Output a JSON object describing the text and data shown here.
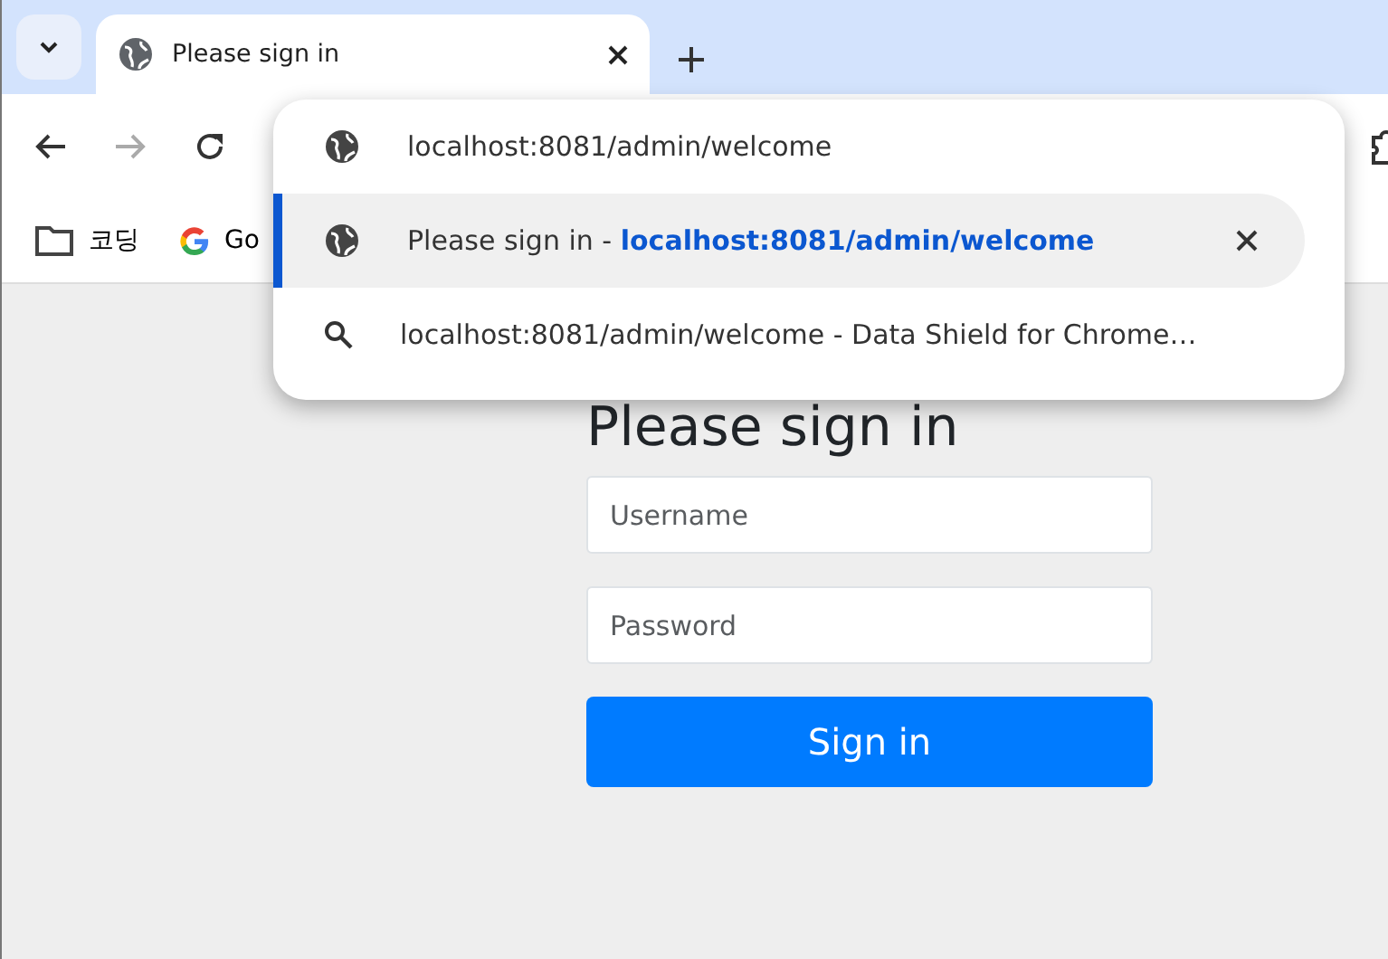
{
  "tab": {
    "title": "Please sign in"
  },
  "bookmarks": [
    {
      "label": "코딩",
      "kind": "folder"
    },
    {
      "label": "Go",
      "kind": "google"
    }
  ],
  "omnibox_suggestions": [
    {
      "kind": "globe",
      "text": "localhost:8081/admin/welcome",
      "selected": false
    },
    {
      "kind": "globe",
      "text": "Please sign in - **localhost:8081/admin/welcome**",
      "selected": true,
      "removable": true
    },
    {
      "kind": "search",
      "text": "localhost:8081/admin/welcome - Data Shield for Chrome…",
      "selected": false
    }
  ],
  "form": {
    "heading": "Please sign in",
    "username_placeholder": "Username",
    "password_placeholder": "Password",
    "submit": "Sign in"
  }
}
